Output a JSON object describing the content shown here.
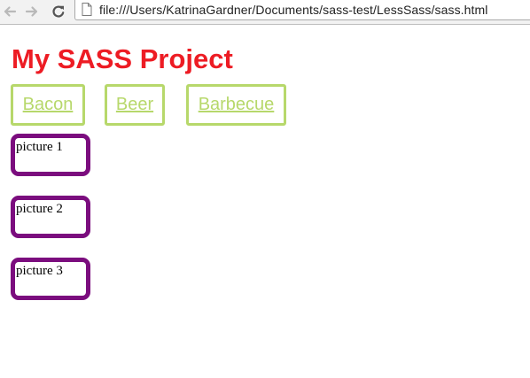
{
  "browser": {
    "url": "file:///Users/KatrinaGardner/Documents/sass-test/LessSass/sass.html"
  },
  "page": {
    "title": "My SASS Project",
    "nav_links": [
      "Bacon",
      "Beer",
      "Barbecue"
    ],
    "pictures": [
      "picture 1",
      "picture 2",
      "picture 3"
    ]
  },
  "colors": {
    "title": "#ed1c24",
    "nav_accent": "#b7d86b",
    "picture_border": "#7b0d7e"
  },
  "icons": {
    "back": "back-arrow-icon",
    "forward": "forward-arrow-icon",
    "reload": "reload-icon",
    "page": "page-icon"
  }
}
